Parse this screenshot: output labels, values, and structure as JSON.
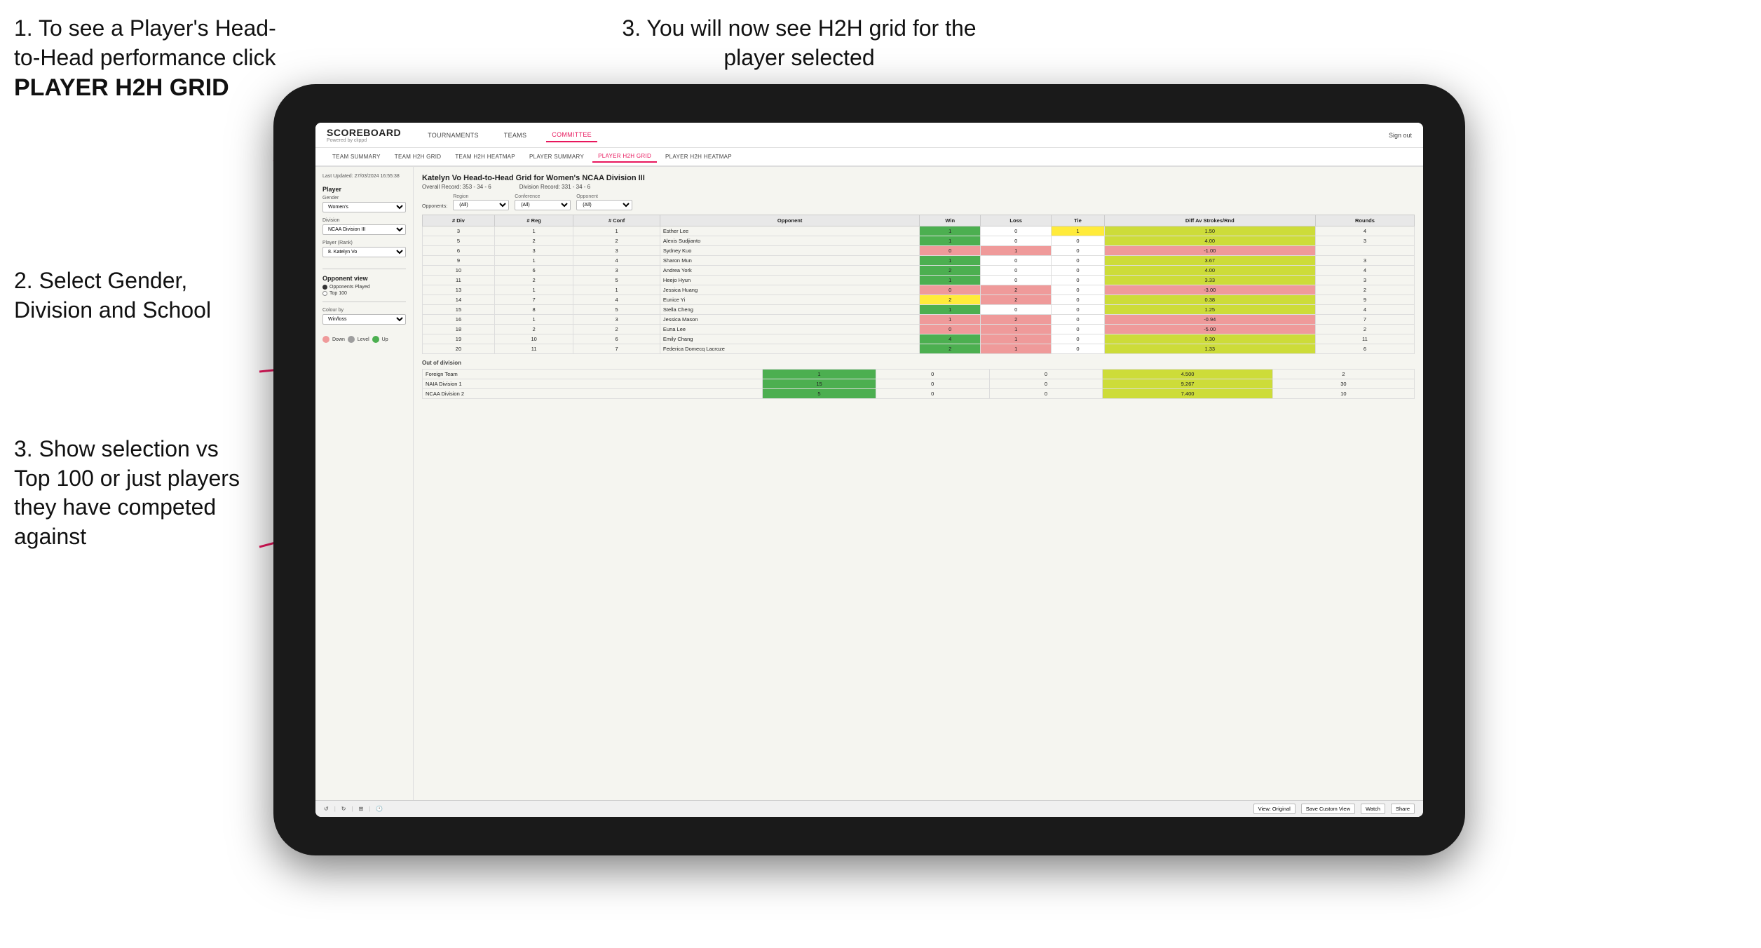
{
  "instructions": {
    "step1_title": "1. To see a Player's Head-to-Head performance click",
    "step1_bold": "PLAYER H2H GRID",
    "step2": "2. Select Gender, Division and School",
    "step3_top": "3. You will now see H2H grid for the player selected",
    "step3_bottom": "3. Show selection vs Top 100 or just players they have competed against"
  },
  "app": {
    "logo": "SCOREBOARD",
    "logo_sub": "Powered by clippd",
    "nav": [
      "TOURNAMENTS",
      "TEAMS",
      "COMMITTEE"
    ],
    "sign_out": "Sign out",
    "sub_nav": [
      "TEAM SUMMARY",
      "TEAM H2H GRID",
      "TEAM H2H HEATMAP",
      "PLAYER SUMMARY",
      "PLAYER H2H GRID",
      "PLAYER H2H HEATMAP"
    ]
  },
  "sidebar": {
    "timestamp": "Last Updated: 27/03/2024 16:55:38",
    "player_label": "Player",
    "gender_label": "Gender",
    "gender_value": "Women's",
    "division_label": "Division",
    "division_value": "NCAA Division III",
    "player_rank_label": "Player (Rank)",
    "player_rank_value": "8. Katelyn Vo",
    "opponent_view_label": "Opponent view",
    "opponent_options": [
      "Opponents Played",
      "Top 100"
    ],
    "opponent_selected": "Opponents Played",
    "colour_by_label": "Colour by",
    "colour_by_value": "Win/loss",
    "colour_legend": [
      "Down",
      "Level",
      "Up"
    ]
  },
  "grid": {
    "title": "Katelyn Vo Head-to-Head Grid for Women's NCAA Division III",
    "overall_record": "Overall Record: 353 - 34 - 6",
    "division_record": "Division Record: 331 - 34 - 6",
    "filters": {
      "region_label": "Region",
      "conference_label": "Conference",
      "opponent_label": "Opponent",
      "opponents_label": "Opponents:",
      "region_value": "(All)",
      "conference_value": "(All)",
      "opponent_value": "(All)"
    },
    "columns": [
      "# Div",
      "# Reg",
      "# Conf",
      "Opponent",
      "Win",
      "Loss",
      "Tie",
      "Diff Av Strokes/Rnd",
      "Rounds"
    ],
    "rows": [
      {
        "div": 3,
        "reg": 1,
        "conf": 1,
        "opponent": "Esther Lee",
        "win": 1,
        "loss": 0,
        "tie": 1,
        "diff": 1.5,
        "rounds": 4,
        "win_color": "green",
        "loss_color": "white",
        "tie_color": "yellow"
      },
      {
        "div": 5,
        "reg": 2,
        "conf": 2,
        "opponent": "Alexis Sudjianto",
        "win": 1,
        "loss": 0,
        "tie": 0,
        "diff": 4.0,
        "rounds": 3,
        "win_color": "green"
      },
      {
        "div": 6,
        "reg": 3,
        "conf": 3,
        "opponent": "Sydney Kuo",
        "win": 0,
        "loss": 1,
        "tie": 0,
        "diff": -1.0,
        "rounds": "",
        "win_color": "red"
      },
      {
        "div": 9,
        "reg": 1,
        "conf": 4,
        "opponent": "Sharon Mun",
        "win": 1,
        "loss": 0,
        "tie": 0,
        "diff": 3.67,
        "rounds": 3,
        "win_color": "green"
      },
      {
        "div": 10,
        "reg": 6,
        "conf": 3,
        "opponent": "Andrea York",
        "win": 2,
        "loss": 0,
        "tie": 0,
        "diff": 4.0,
        "rounds": 4,
        "win_color": "green"
      },
      {
        "div": 11,
        "reg": 2,
        "conf": 5,
        "opponent": "Heejo Hyun",
        "win": 1,
        "loss": 0,
        "tie": 0,
        "diff": 3.33,
        "rounds": 3,
        "win_color": "green"
      },
      {
        "div": 13,
        "reg": 1,
        "conf": 1,
        "opponent": "Jessica Huang",
        "win": 0,
        "loss": 2,
        "tie": 0,
        "diff": -3.0,
        "rounds": 2,
        "win_color": "red"
      },
      {
        "div": 14,
        "reg": 7,
        "conf": 4,
        "opponent": "Eunice Yi",
        "win": 2,
        "loss": 2,
        "tie": 0,
        "diff": 0.38,
        "rounds": 9,
        "win_color": "yellow"
      },
      {
        "div": 15,
        "reg": 8,
        "conf": 5,
        "opponent": "Stella Cheng",
        "win": 1,
        "loss": 0,
        "tie": 0,
        "diff": 1.25,
        "rounds": 4,
        "win_color": "green"
      },
      {
        "div": 16,
        "reg": 1,
        "conf": 3,
        "opponent": "Jessica Mason",
        "win": 1,
        "loss": 2,
        "tie": 0,
        "diff": -0.94,
        "rounds": 7,
        "win_color": "red"
      },
      {
        "div": 18,
        "reg": 2,
        "conf": 2,
        "opponent": "Euna Lee",
        "win": 0,
        "loss": 1,
        "tie": 0,
        "diff": -5.0,
        "rounds": 2,
        "win_color": "red"
      },
      {
        "div": 19,
        "reg": 10,
        "conf": 6,
        "opponent": "Emily Chang",
        "win": 4,
        "loss": 1,
        "tie": 0,
        "diff": 0.3,
        "rounds": 11,
        "win_color": "yellow"
      },
      {
        "div": 20,
        "reg": 11,
        "conf": 7,
        "opponent": "Federica Domecq Lacroze",
        "win": 2,
        "loss": 1,
        "tie": 0,
        "diff": 1.33,
        "rounds": 6,
        "win_color": "green"
      }
    ],
    "out_of_division_label": "Out of division",
    "out_of_division_rows": [
      {
        "opponent": "Foreign Team",
        "win": 1,
        "loss": 0,
        "tie": 0,
        "diff": 4.5,
        "rounds": 2
      },
      {
        "opponent": "NAIA Division 1",
        "win": 15,
        "loss": 0,
        "tie": 0,
        "diff": 9.267,
        "rounds": 30
      },
      {
        "opponent": "NCAA Division 2",
        "win": 5,
        "loss": 0,
        "tie": 0,
        "diff": 7.4,
        "rounds": 10
      }
    ]
  },
  "toolbar": {
    "view_original": "View: Original",
    "save_custom": "Save Custom View",
    "watch": "Watch",
    "share": "Share"
  }
}
